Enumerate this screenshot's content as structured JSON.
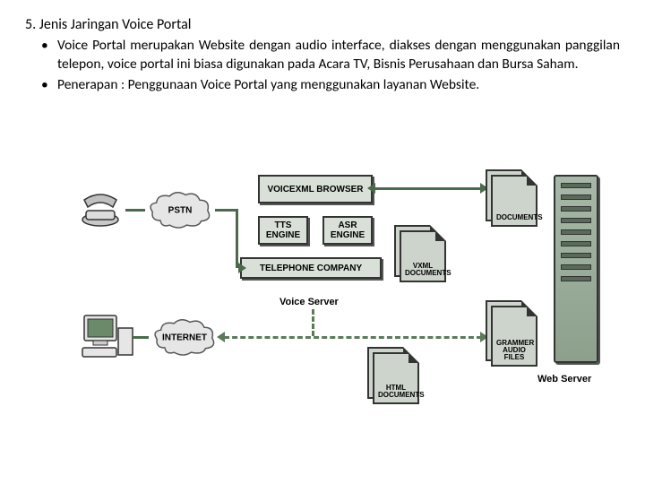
{
  "heading": "5. Jenis Jaringan Voice Portal",
  "bullets": [
    "Voice Portal merupakan Website dengan audio interface, diakses dengan menggunakan panggilan telepon, voice portal ini biasa digunakan pada Acara TV, Bisnis Perusahaan dan Bursa Saham.",
    "Penerapan : Penggunaan Voice Portal yang menggunakan layanan Website."
  ],
  "diagram": {
    "cloud_pstn": "PSTN",
    "cloud_internet": "INTERNET",
    "box_voicexml_browser": "VOICEXML BROWSER",
    "box_tts": "TTS ENGINE",
    "box_asr": "ASR ENGINE",
    "box_telco": "TELEPHONE COMPANY",
    "doc_documents": "DOCUMENTS",
    "doc_vxml": "VXML DOCUMENTS",
    "doc_html": "HTML DOCUMENTS",
    "doc_grammar": "GRAMMER AUDIO FILES",
    "label_voice_server": "Voice Server",
    "label_web_server": "Web Server"
  }
}
